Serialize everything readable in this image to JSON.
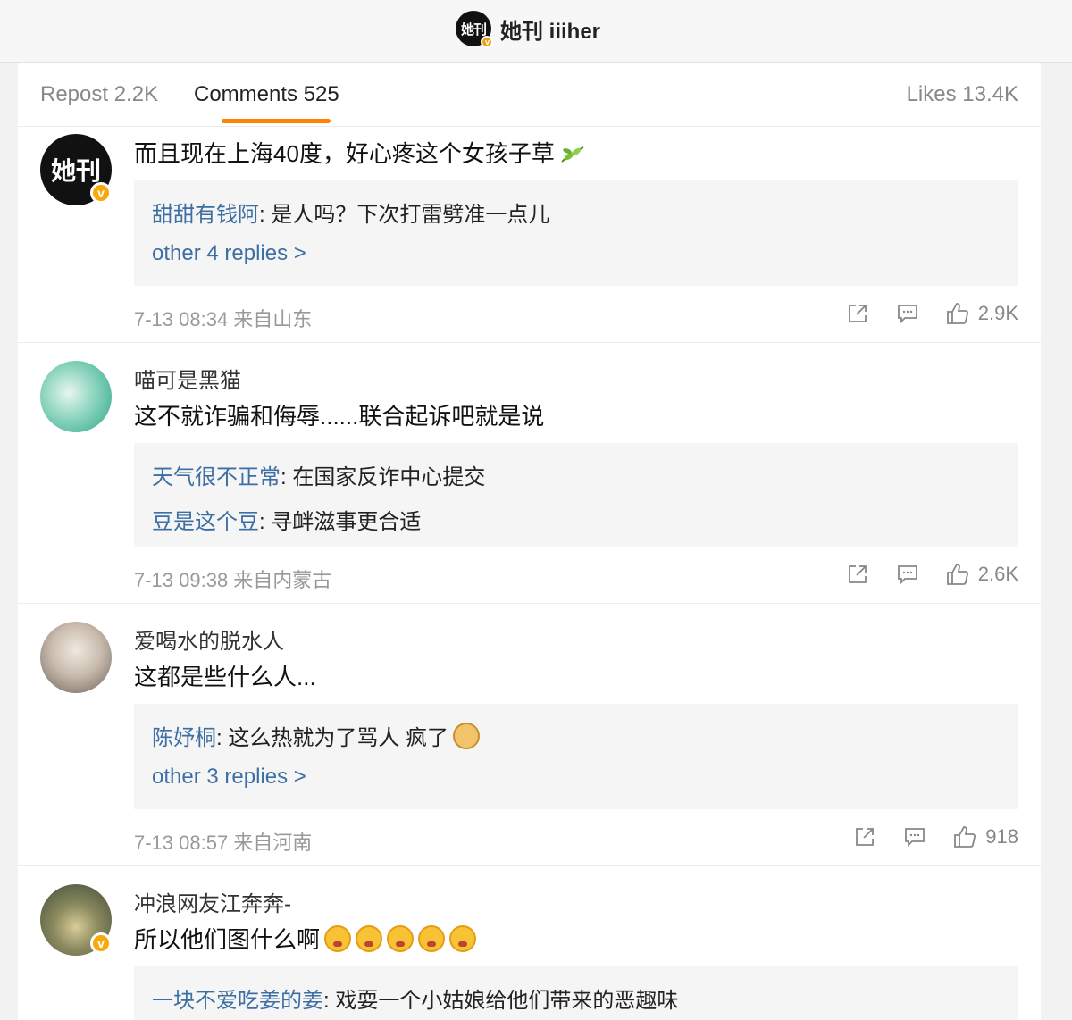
{
  "header": {
    "logo_text": "她刊",
    "account_name": "她刊 iiiher"
  },
  "tabs": {
    "repost": "Repost 2.2K",
    "comments": "Comments 525",
    "likes": "Likes 13.4K"
  },
  "colors": {
    "accent": "#ff8200",
    "link": "#3d6fa4",
    "verified": "#f7a80b"
  },
  "comments": [
    {
      "username": "",
      "text": "而且现在上海40度，好心疼这个女孩子草",
      "avatar_label": "她刊",
      "replies": [
        {
          "name": "甜甜有钱阿",
          "text": ": 是人吗？下次打雷劈准一点儿"
        }
      ],
      "more": "other 4 replies >",
      "meta": "7-13 08:34  来自山东",
      "likes": "2.9K"
    },
    {
      "username": "喵可是黑猫",
      "text": "这不就诈骗和侮辱......联合起诉吧就是说",
      "replies": [
        {
          "name": "天气很不正常",
          "text": ": 在国家反诈中心提交"
        },
        {
          "name": "豆是这个豆",
          "text": ": 寻衅滋事更合适"
        }
      ],
      "meta": "7-13 09:38  来自内蒙古",
      "likes": "2.6K"
    },
    {
      "username": "爱喝水的脱水人",
      "text": "这都是些什么人...",
      "replies": [
        {
          "name": "陈妤桐",
          "text": ": 这么热就为了骂人 疯了"
        }
      ],
      "more": "other 3 replies >",
      "meta": "7-13 08:57  来自河南",
      "likes": "918"
    },
    {
      "username": "冲浪网友江奔奔-",
      "text": "所以他们图什么啊",
      "replies": [
        {
          "name": "一块不爱吃姜的姜",
          "text": ": 戏耍一个小姑娘给他们带来的恶趣味"
        }
      ]
    }
  ]
}
